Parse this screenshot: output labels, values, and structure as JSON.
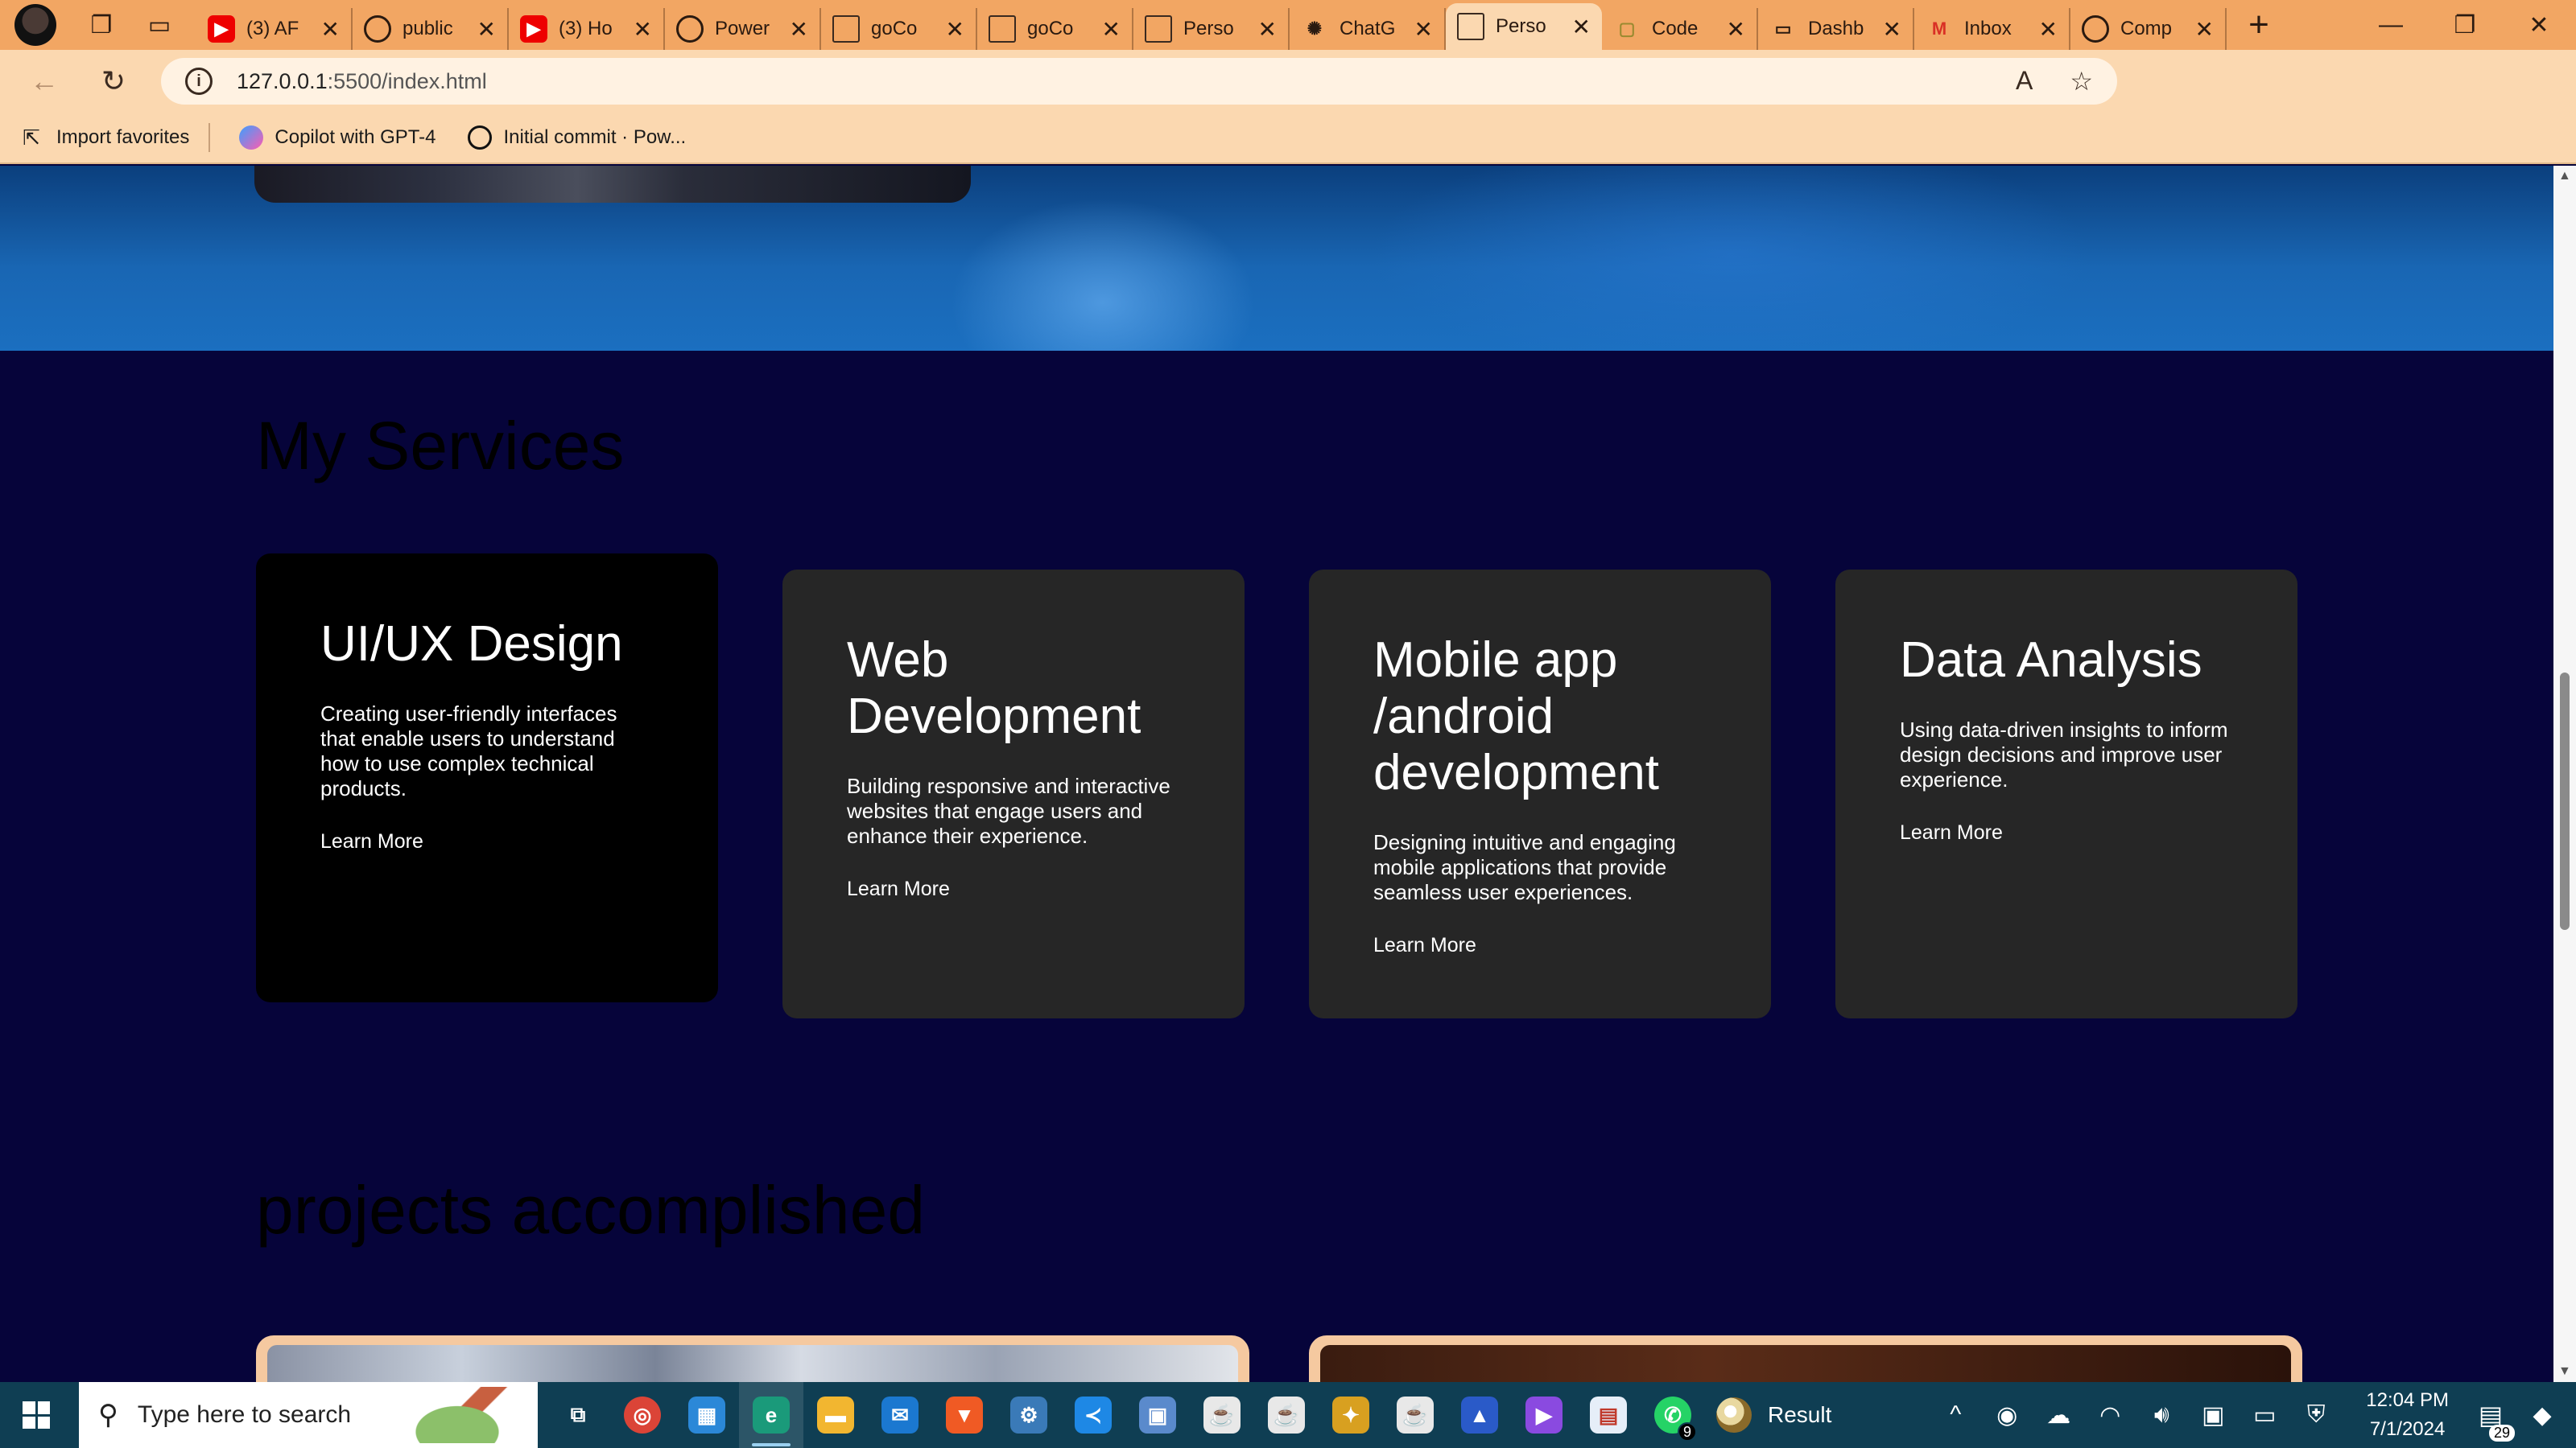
{
  "browser": {
    "tabs": [
      {
        "icon": "youtube-icon",
        "label": "(3) AF",
        "active": false
      },
      {
        "icon": "github-icon",
        "label": "public",
        "active": false
      },
      {
        "icon": "youtube-icon",
        "label": "(3) Ho",
        "active": false
      },
      {
        "icon": "github-icon",
        "label": "Power",
        "active": false
      },
      {
        "icon": "document-icon",
        "label": "goCo",
        "active": false
      },
      {
        "icon": "document-icon",
        "label": "goCo",
        "active": false
      },
      {
        "icon": "document-icon",
        "label": "Perso",
        "active": false
      },
      {
        "icon": "chatgpt-icon",
        "label": "ChatG",
        "active": false
      },
      {
        "icon": "document-icon",
        "label": "Perso",
        "active": true
      },
      {
        "icon": "code-icon",
        "label": "Code",
        "active": false
      },
      {
        "icon": "dashboard-icon",
        "label": "Dashb",
        "active": false
      },
      {
        "icon": "gmail-icon",
        "label": "Inbox",
        "active": false
      },
      {
        "icon": "github-icon",
        "label": "Comp",
        "active": false
      }
    ],
    "address": {
      "host": "127.0.0.1",
      "path": ":5500/index.html"
    },
    "favorites": [
      {
        "icon": "import-icon",
        "label": "Import favorites"
      },
      {
        "icon": "copilot-icon",
        "label": "Copilot with GPT-4"
      },
      {
        "icon": "github-icon",
        "label": "Initial commit · Pow..."
      }
    ]
  },
  "page": {
    "services_title": "My Services",
    "services": [
      {
        "title": "UI/UX Design",
        "description": "Creating user-friendly interfaces that enable users to understand how to use complex technical products.",
        "link": "Learn More"
      },
      {
        "title": "Web Development",
        "description": "Building responsive and interactive websites that engage users and enhance their experience.",
        "link": "Learn More"
      },
      {
        "title": "Mobile app /android development",
        "description": "Designing intuitive and engaging mobile applications that provide seamless user experiences.",
        "link": "Learn More"
      },
      {
        "title": "Data Analysis",
        "description": "Using data-driven insights to inform design decisions and improve user experience.",
        "link": "Learn More"
      }
    ],
    "projects_title": "projects accomplished"
  },
  "taskbar": {
    "search_placeholder": "Type here to search",
    "apps": [
      {
        "icon": "task-view-icon",
        "active": false
      },
      {
        "icon": "chrome-icon",
        "active": false
      },
      {
        "icon": "microsoft-store-icon",
        "active": false
      },
      {
        "icon": "edge-icon",
        "active": true
      },
      {
        "icon": "file-explorer-icon",
        "active": false
      },
      {
        "icon": "mail-icon",
        "active": false
      },
      {
        "icon": "brave-icon",
        "active": false
      },
      {
        "icon": "control-panel-icon",
        "active": false
      },
      {
        "icon": "vscode-icon",
        "active": false
      },
      {
        "icon": "virtualbox-icon",
        "active": false
      },
      {
        "icon": "java-icon",
        "active": false
      },
      {
        "icon": "java-icon",
        "active": false
      },
      {
        "icon": "netbeans-icon",
        "active": false
      },
      {
        "icon": "java-icon",
        "active": false
      },
      {
        "icon": "photos-icon",
        "active": false
      },
      {
        "icon": "clipchamp-icon",
        "active": false
      },
      {
        "icon": "paint-icon",
        "active": false
      },
      {
        "icon": "whatsapp-icon",
        "active": false,
        "badge": "9"
      }
    ],
    "running_label": "Result",
    "time": "12:04 PM",
    "date": "7/1/2024",
    "notification_count": "29"
  }
}
